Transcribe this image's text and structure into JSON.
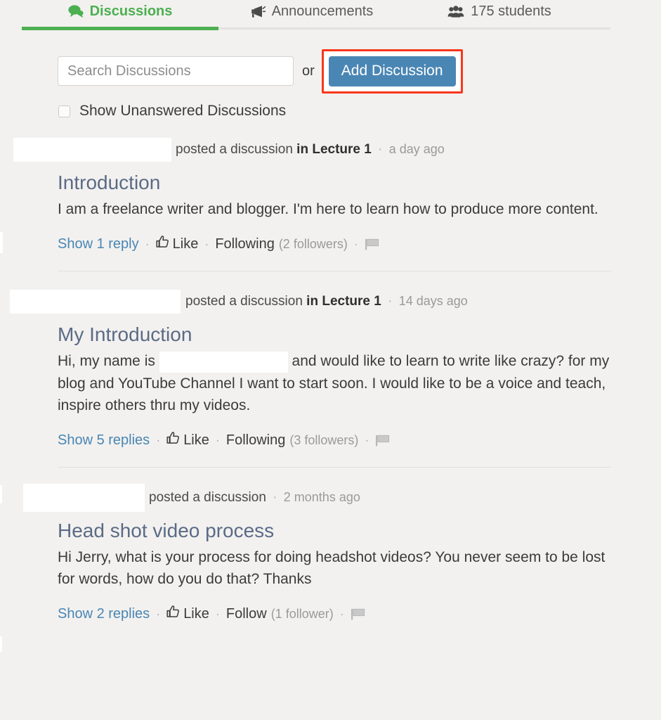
{
  "tabs": [
    {
      "id": "discussions",
      "label": "Discussions",
      "icon": "comment-icon",
      "active": true,
      "color": "#4caf50"
    },
    {
      "id": "announcements",
      "label": "Announcements",
      "icon": "megaphone-icon",
      "active": false
    },
    {
      "id": "students",
      "label": "175 students",
      "icon": "users-icon",
      "active": false
    }
  ],
  "toolbar": {
    "search_placeholder": "Search Discussions",
    "search_value": "",
    "or_label": "or",
    "add_label": "Add Discussion",
    "add_button_color": "#4a86b4",
    "highlight_color": "#f9361b"
  },
  "filter": {
    "unanswered_label": "Show Unanswered Discussions",
    "unanswered_checked": false
  },
  "posts": [
    {
      "author_redacted": true,
      "action": "posted a discussion",
      "context": "in Lecture 1",
      "separator": "·",
      "time": "a day ago",
      "title": "Introduction",
      "body_before": "I am a freelance writer and blogger. I'm here to learn how to produce more content.",
      "body_redacted": false,
      "body_after": "",
      "replies_label": "Show 1 reply",
      "like_label": "Like",
      "follow_label": "Following",
      "followers_label": "(2 followers)",
      "flag_icon": "flag-icon"
    },
    {
      "author_redacted": true,
      "action": "posted a discussion",
      "context": "in Lecture 1",
      "separator": "·",
      "time": "14 days ago",
      "title": "My Introduction",
      "body_before": "Hi, my name is ",
      "body_redacted": true,
      "body_after": " and would like to learn to write like crazy? for my blog and YouTube Channel I want to start soon. I would like to be a voice and teach, inspire others thru my videos.",
      "replies_label": "Show 5 replies",
      "like_label": "Like",
      "follow_label": "Following",
      "followers_label": "(3 followers)",
      "flag_icon": "flag-icon"
    },
    {
      "author_redacted": true,
      "action": "posted a discussion",
      "context": "",
      "separator": "·",
      "time": "2 months ago",
      "title": "Head shot video process",
      "body_before": "Hi Jerry, what is your process for doing headshot videos? You never seem to be lost for words, how do you do that? Thanks",
      "body_redacted": false,
      "body_after": "",
      "replies_label": "Show 2 replies",
      "like_label": "Like",
      "follow_label": "Follow",
      "followers_label": "(1 follower)",
      "flag_icon": "flag-icon"
    }
  ]
}
